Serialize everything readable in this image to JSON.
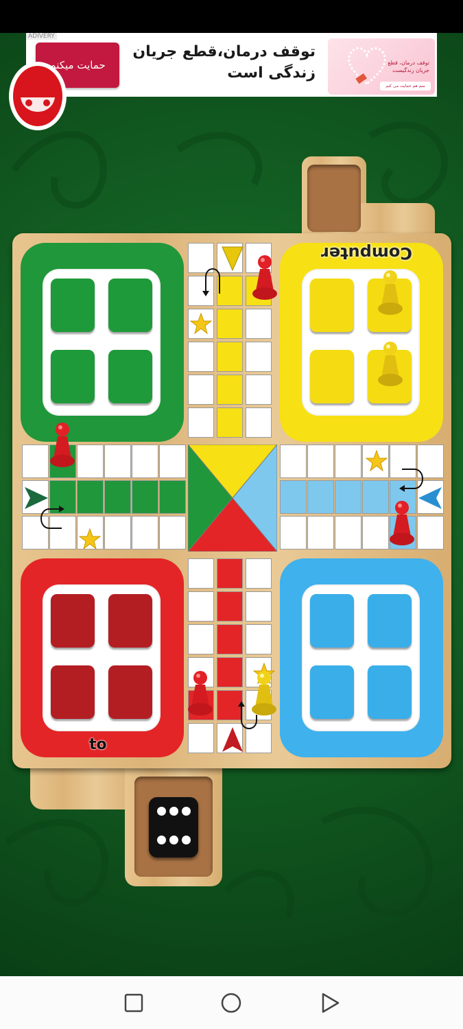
{
  "ad": {
    "tag": "ADIVERY",
    "cta_label": "حمایت میکنم",
    "headline": "توقف درمان،قطع جریان زندگی است",
    "thumb_text": "توقف درمان، قطع جریان زندگیست",
    "thumb_button": "منم هم حمایت می کنم"
  },
  "players": {
    "bottom_label": "to",
    "top_label": "Computer"
  },
  "colors": {
    "green": "#20973a",
    "yellow": "#f7e014",
    "red": "#e32527",
    "blue": "#3fb1ec"
  },
  "dice": {
    "value": 6
  },
  "navbar": [
    "back-icon",
    "home-icon",
    "recents-icon"
  ]
}
